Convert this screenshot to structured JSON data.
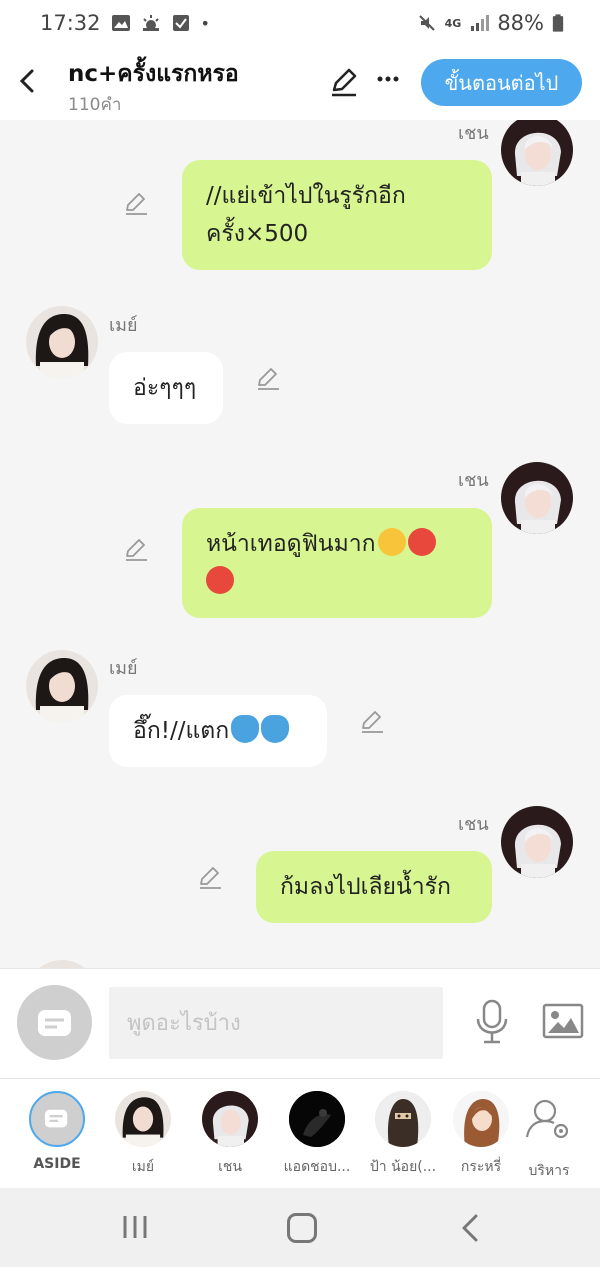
{
  "status_bar": {
    "time": "17:32",
    "network": "4G",
    "battery": "88%"
  },
  "header": {
    "title": "nc+ครั้งแรกหรอ",
    "subtitle": "110คำ",
    "next_button": "ขั้นตอนต่อไป"
  },
  "messages": [
    {
      "sender": "เชน",
      "side": "right",
      "text": "//แย่เข้าไปในรูรักอีก ครั้ง×500"
    },
    {
      "sender": "เมย์",
      "side": "left",
      "text": "อ่ะๆๆๆ"
    },
    {
      "sender": "เชน",
      "side": "right",
      "text": "หน้าเทอดูฟินมาก"
    },
    {
      "sender": "เมย์",
      "side": "left",
      "text": "อึ๊ก!//แตก"
    },
    {
      "sender": "เชน",
      "side": "right",
      "text": "ก้มลงไปเลียน้ำรัก"
    }
  ],
  "input": {
    "placeholder": "พูดอะไรบ้าง"
  },
  "characters": [
    {
      "label": "ASIDE"
    },
    {
      "label": "เมย์"
    },
    {
      "label": "เชน"
    },
    {
      "label": "แอดชอบ..."
    },
    {
      "label": "ป้า น้อย(..."
    },
    {
      "label": "กระหรี่"
    },
    {
      "label": "บริหาร"
    }
  ],
  "colors": {
    "accent": "#4da8ee",
    "right_bubble": "#d7f590",
    "left_bubble": "#ffffff",
    "background": "#f5f5f5"
  },
  "icons": [
    "back-icon",
    "edit-icon",
    "more-icon",
    "pencil-icon",
    "aside-icon",
    "mic-icon",
    "gallery-icon",
    "manage-icon"
  ]
}
